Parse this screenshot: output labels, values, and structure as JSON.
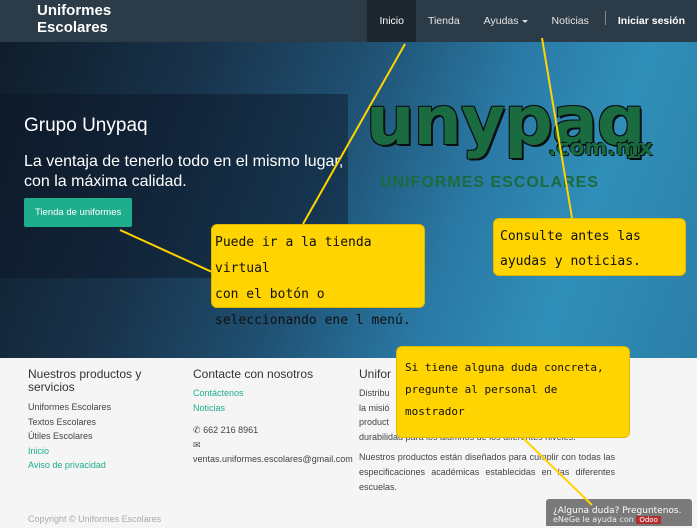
{
  "navbar": {
    "brand_line1": "Uniformes",
    "brand_line2": "Escolares",
    "items": [
      {
        "label": "Inicio"
      },
      {
        "label": "Tienda"
      },
      {
        "label": "Ayudas"
      },
      {
        "label": "Noticias"
      },
      {
        "label": "Iniciar sesión"
      }
    ]
  },
  "hero": {
    "title": "Grupo Unypaq",
    "subtitle": "La ventaja de tenerlo todo en el mismo lugar, con la máxima calidad.",
    "button": "Tienda de uniformes",
    "logo_main": "unypaq",
    "logo_domain": ".com.mx",
    "logo_tagline": "UNIFORMES ESCOLARES"
  },
  "footer": {
    "col1": {
      "title": "Nuestros productos y servicios",
      "items": [
        "Uniformes Escolares",
        "Textos Escolares",
        "Útiles Escolares",
        "Inicio",
        "Aviso de privacidad"
      ]
    },
    "col2": {
      "title": "Contacte con nosotros",
      "links": [
        "Contáctenos",
        "Noticias"
      ],
      "phone": "662 216 8961",
      "email": "ventas.uniformes.escolares@gmail.com"
    },
    "col3": {
      "title": "Unifor",
      "line1": "Distribu",
      "line2": "la misió",
      "line3": "product",
      "line4": "durabilidad para los alumnos de los diferentes niveles.",
      "para2": "Nuestros productos están diseñados para cumplir con todas las especificaciones académicas establecidas en las diferentes escuelas."
    },
    "copyright": "Copyright © Uniformes Escolares"
  },
  "chat": {
    "question": "¿Alguna duda? Preguntenos.",
    "sub_prefix": "eNeGe",
    "sub_text": "le ayuda con",
    "sub_brand": "Odoo"
  },
  "callouts": {
    "tienda": [
      "Puede ir a la tienda virtual",
      "con el botón o",
      "seleccionando ene l menú."
    ],
    "ayudas": [
      "Consulte antes las",
      "ayudas y noticias."
    ],
    "duda": [
      "Si tiene alguna duda concreta,",
      "pregunte al personal de",
      "mostrador"
    ]
  },
  "colors": {
    "navbar": "#2b3b47",
    "accent": "#1fae8c",
    "callout": "#ffd400"
  }
}
